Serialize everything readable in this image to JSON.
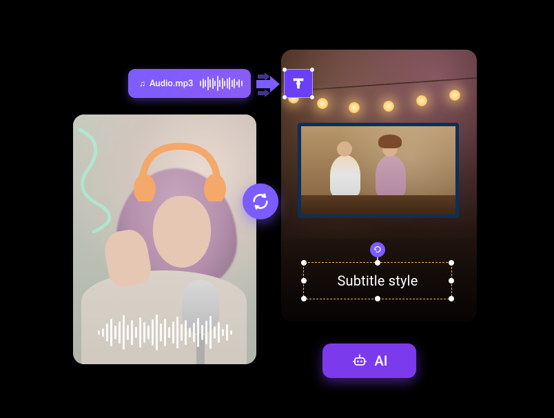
{
  "audio_chip": {
    "filename": "Audio.mp3"
  },
  "subtitle": {
    "text": "Subtitle style"
  },
  "ai_button": {
    "label": "AI"
  },
  "colors": {
    "accent": "#7c5cff",
    "ai_btn": "#7c3aed",
    "selection_border": "#ffb84d"
  }
}
